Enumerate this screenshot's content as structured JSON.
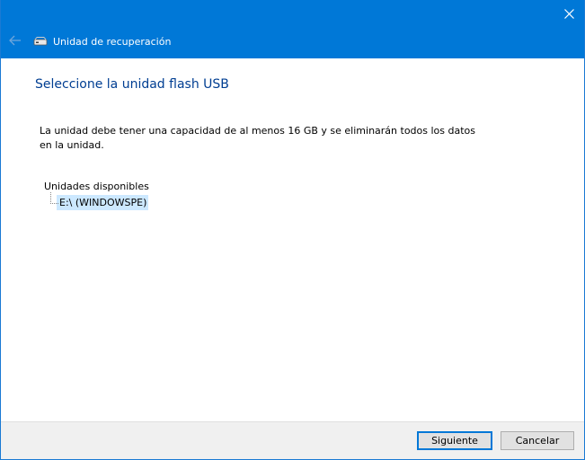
{
  "titlebar": {
    "title": "Unidad de recuperación",
    "back_icon": "arrow-left-icon",
    "close_icon": "close-icon",
    "app_icon": "drive-icon"
  },
  "main": {
    "heading": "Seleccione la unidad flash USB",
    "description": "La unidad debe tener una capacidad de al menos 16 GB y se eliminarán todos los datos en la unidad.",
    "tree": {
      "root_label": "Unidades disponibles",
      "items": [
        {
          "label": "E:\\ (WINDOWSPE)",
          "selected": true
        }
      ]
    }
  },
  "footer": {
    "next_label": "Siguiente",
    "cancel_label": "Cancelar"
  },
  "colors": {
    "titlebar": "#0078d7",
    "heading": "#003e92",
    "selection": "#cce8ff"
  }
}
